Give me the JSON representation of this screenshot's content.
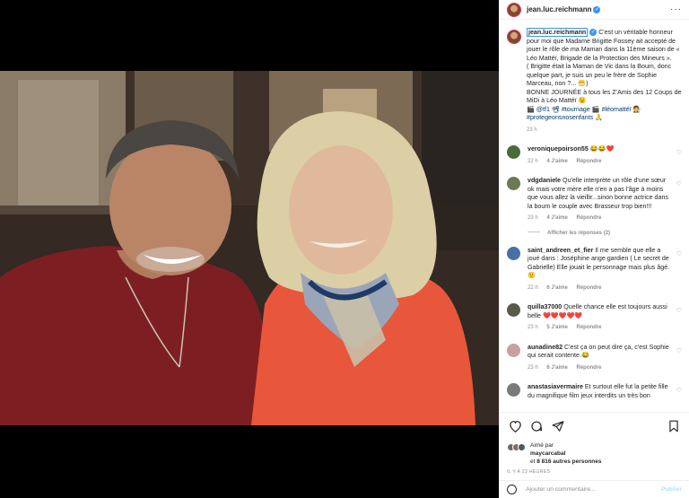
{
  "post": {
    "username": "jean.luc.reichmann",
    "more_label": "···"
  },
  "caption": {
    "username": "jean.luc.reichmann",
    "line1": "C'est un véritable honneur pour moi que Madame Brigitte Fossey ait accepté de jouer le rôle de ma Maman dans la 11ème saison de « Léo Mattéï, Brigade de la Protection des Mineurs ».",
    "line2": "( Brigitte était la Maman de Vic dans la Boum, donc quelque part, je suis un peu le frère de Sophie Marceau, non ?... 😁)",
    "line3": "BONNE JOURNÉE à tous les Z'Amis des 12 Coups de MiDi à Léo Mattéï 😉",
    "line4_prefix": "🎬 @tf1 📽 #tournage 🎬 #léomattéï 🧑‍⚖️",
    "line5": "#protegeonsnosenfants 🙏",
    "time": "23 h"
  },
  "comments": [
    {
      "user": "veroniquepoirson55",
      "text": "😂😂❤️",
      "time": "22 h",
      "likes": "4 J'aime",
      "reply": "Répondre",
      "color": "#4a6a3a"
    },
    {
      "user": "vdgdaniele",
      "text": "Qu'elle interprète un rôle d'une sœur ok mais votre mère elle n'en a pas l'âge à moins que vous allez la vieillir...sinon bonne actrice dans la boum le couple avec Brasseur trop bien!!!",
      "time": "23 h",
      "likes": "4 J'aime",
      "reply": "Répondre",
      "color": "#6b7a55"
    },
    {
      "user": "saint_andreen_et_fier",
      "text": "Il me semble que elle a joué dans : Joséphine ange gardien ( Le secret de Gabrielle) Elle jouait le personnage mais plus âgé. 🙁",
      "time": "22 h",
      "likes": "6 J'aime",
      "reply": "Répondre",
      "color": "#4a6fa5"
    },
    {
      "user": "quilla37000",
      "text": "Quelle chance elle est toujours aussi belle ❤️❤️❤️❤️❤️",
      "time": "23 h",
      "likes": "5 J'aime",
      "reply": "Répondre",
      "color": "#5a5a4a"
    },
    {
      "user": "aunadine82",
      "text": "C'est ça on peut dire ça, c'est Sophie qui serait contente.😂",
      "time": "23 h",
      "likes": "6 J'aime",
      "reply": "Répondre",
      "color": "#c9a0a0"
    },
    {
      "user": "anastasiavermaire",
      "text": "Et surtout elle fut la petite fille du magnifique film jeux interdits un très bon",
      "time": "",
      "likes": "",
      "reply": "",
      "color": "#7a7a7a"
    }
  ],
  "replies_label": "Afficher les réponses (2)",
  "likes": {
    "prefix": "Aimé par",
    "user": "maycarcabal",
    "suffix_and": "et",
    "others": "8 816 autres personnes"
  },
  "date": "IL Y A 23 HEURES",
  "add_comment": {
    "placeholder": "Ajouter un commentaire...",
    "publish": "Publier"
  }
}
